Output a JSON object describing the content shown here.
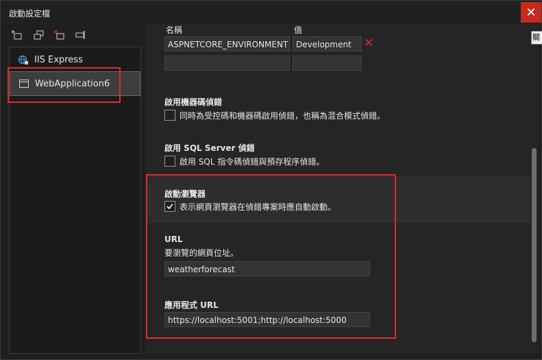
{
  "window": {
    "title": "啟動設定檔",
    "tooltip": "關閉"
  },
  "profiles": [
    {
      "label": "IIS Express"
    },
    {
      "label": "WebApplication6"
    }
  ],
  "env": {
    "name_header": "名稱",
    "value_header": "值",
    "rows": [
      {
        "name": "ASPNETCORE_ENVIRONMENT",
        "value": "Development"
      },
      {
        "name": "",
        "value": ""
      }
    ]
  },
  "native_debug": {
    "title": "啟用機器碼偵錯",
    "desc": "同時為受控碼和機器碼啟用偵錯，也稱為混合模式偵錯。",
    "checked": false
  },
  "sql_debug": {
    "title": "啟用 SQL Server 偵錯",
    "desc": "啟用 SQL 指令碼偵錯與預存程序偵錯。",
    "checked": false
  },
  "browser": {
    "title": "啟動瀏覽器",
    "desc": "表示網頁瀏覽器在偵錯專案時應自動啟動。",
    "checked": true
  },
  "url": {
    "title": "URL",
    "desc": "要瀏覽的網頁位址。",
    "value": "weatherforecast"
  },
  "app_url": {
    "title": "應用程式 URL",
    "value": "https://localhost:5001;http://localhost:5000"
  },
  "colors": {
    "accent_red": "#e32b2b",
    "close_red": "#c42b1c"
  }
}
